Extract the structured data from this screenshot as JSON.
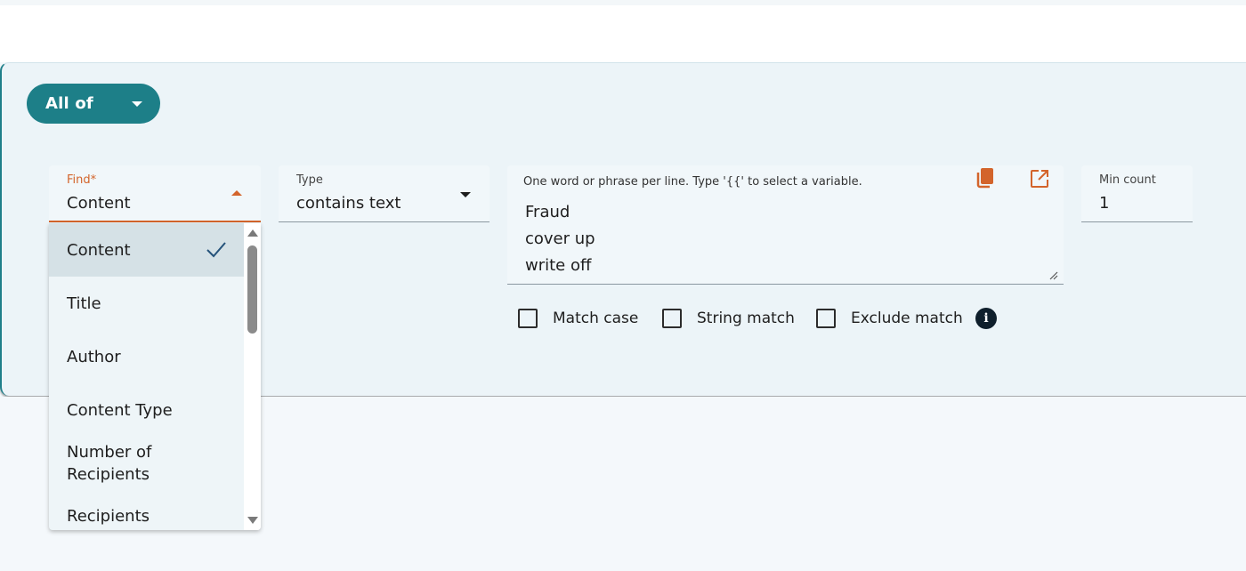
{
  "condition_group": {
    "label": "All of"
  },
  "find_field": {
    "label": "Find*",
    "value": "Content",
    "options": [
      {
        "label": "Content",
        "selected": true
      },
      {
        "label": "Title",
        "selected": false
      },
      {
        "label": "Author",
        "selected": false
      },
      {
        "label": "Content Type",
        "selected": false
      },
      {
        "label": "Number of Recipients",
        "selected": false
      },
      {
        "label": "Recipients",
        "selected": false
      }
    ]
  },
  "type_field": {
    "label": "Type",
    "value": "contains text"
  },
  "phrases_field": {
    "placeholder": "One word or phrase per line. Type '{{' to select a variable.",
    "lines": [
      "Fraud",
      "cover up",
      "write off"
    ]
  },
  "min_count_field": {
    "label": "Min count",
    "value": "1"
  },
  "options": {
    "match_case": {
      "label": "Match case",
      "checked": false
    },
    "string_match": {
      "label": "String match",
      "checked": false
    },
    "exclude_match": {
      "label": "Exclude match",
      "checked": false
    }
  },
  "icons": {
    "copy": "copy-icon",
    "open_external": "open-external-icon",
    "info": "info-icon",
    "check": "checkmark-icon"
  },
  "colors": {
    "accent_teal": "#1d7f88",
    "accent_orange": "#d3642b",
    "panel_bg": "#ecf4f8"
  }
}
